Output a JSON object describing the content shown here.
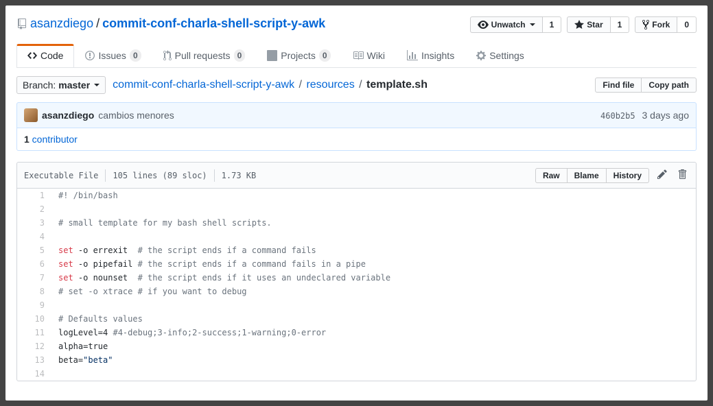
{
  "repo": {
    "owner": "asanzdiego",
    "name": "commit-conf-charla-shell-script-y-awk"
  },
  "actions": {
    "watch": {
      "label": "Unwatch",
      "count": "1"
    },
    "star": {
      "label": "Star",
      "count": "1"
    },
    "fork": {
      "label": "Fork",
      "count": "0"
    }
  },
  "tabs": {
    "code": "Code",
    "issues": {
      "label": "Issues",
      "count": "0"
    },
    "pulls": {
      "label": "Pull requests",
      "count": "0"
    },
    "projects": {
      "label": "Projects",
      "count": "0"
    },
    "wiki": "Wiki",
    "insights": "Insights",
    "settings": "Settings"
  },
  "branch": {
    "label": "Branch:",
    "current": "master"
  },
  "breadcrumb": {
    "root": "commit-conf-charla-shell-script-y-awk",
    "folder": "resources",
    "file": "template.sh"
  },
  "filenav": {
    "find": "Find file",
    "copy": "Copy path"
  },
  "commit": {
    "author": "asanzdiego",
    "message": "cambios menores",
    "sha": "460b2b5",
    "time": "3 days ago"
  },
  "contributors": {
    "count": "1",
    "label": " contributor"
  },
  "fileinfo": {
    "exec": "Executable File",
    "lines": "105 lines (89 sloc)",
    "size": "1.73 KB"
  },
  "fileactions": {
    "raw": "Raw",
    "blame": "Blame",
    "history": "History"
  },
  "code": {
    "l1": "#! /bin/bash",
    "l3": "# small template for my bash shell scripts.",
    "l5a": "set",
    "l5b": " -o errexit  ",
    "l5c": "# the script ends if a command fails",
    "l6a": "set",
    "l6b": " -o pipefail ",
    "l6c": "# the script ends if a command fails in a pipe",
    "l7a": "set",
    "l7b": " -o nounset  ",
    "l7c": "# the script ends if it uses an undeclared variable",
    "l8": "# set -o xtrace # if you want to debug",
    "l10": "# Defaults values",
    "l11a": "logLevel=4 ",
    "l11b": "#4-debug;3-info;2-success;1-warning;0-error",
    "l12": "alpha=true",
    "l13a": "beta=",
    "l13b": "\"beta\""
  }
}
